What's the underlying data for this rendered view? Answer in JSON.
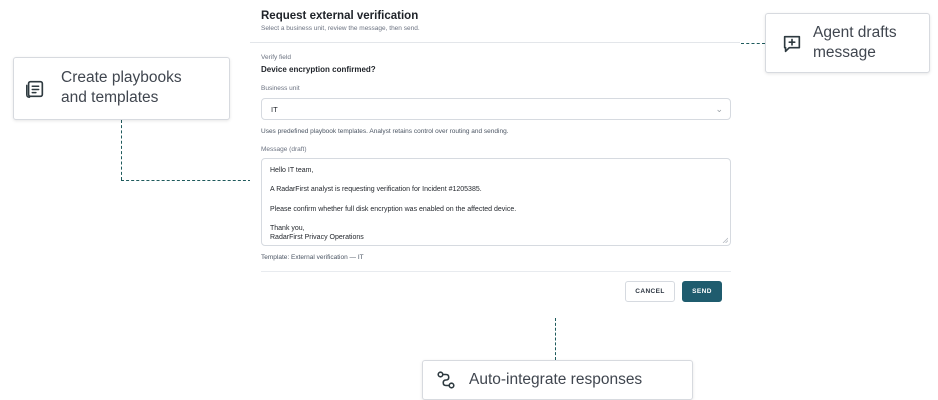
{
  "modal": {
    "title": "Request external verification",
    "subtitle": "Select a business unit, review the message, then send.",
    "verify_field_label": "Verify field",
    "verify_field_value": "Device encryption confirmed?",
    "business_unit_label": "Business unit",
    "business_unit_value": "IT",
    "playbook_note": "Uses predefined playbook templates. Analyst retains control over routing and sending.",
    "message_label": "Message (draft)",
    "message_lines": [
      "Hello IT team,",
      "A RadarFirst analyst is requesting verification for Incident #1205385.",
      "Please confirm whether full disk encryption was enabled on the affected device.",
      "Thank you,",
      "RadarFirst Privacy Operations"
    ],
    "template_note": "Template: External verification — IT",
    "cancel_label": "CANCEL",
    "send_label": "SEND"
  },
  "callouts": {
    "playbooks_line1": "Create playbooks",
    "playbooks_line2": "and templates",
    "drafts_line1": "Agent drafts",
    "drafts_line2": "message",
    "integrate": "Auto-integrate responses"
  },
  "colors": {
    "accent": "#1f5c6e",
    "connector": "#1e5a5c",
    "icon": "#2e3a40"
  }
}
